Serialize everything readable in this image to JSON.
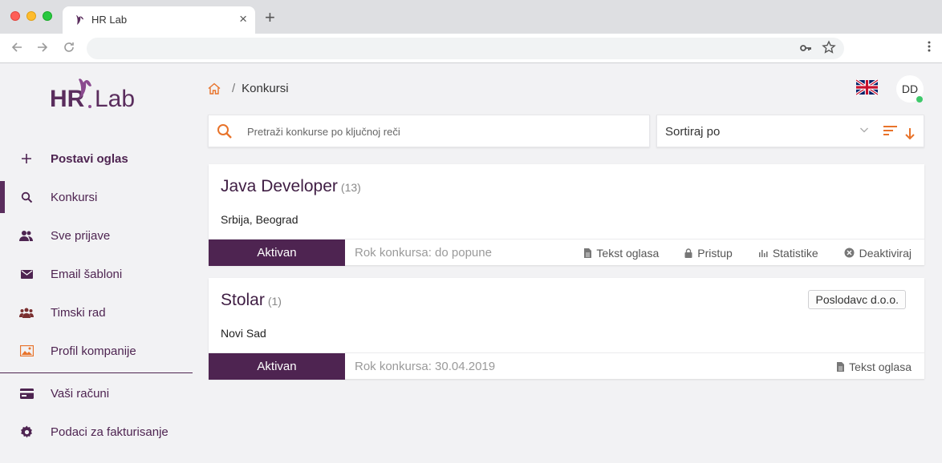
{
  "browser": {
    "tab_title": "HR Lab",
    "tab_close": "×",
    "new_tab": "+",
    "icons": [
      "back-arrow-icon",
      "forward-arrow-icon",
      "reload-icon",
      "key-icon",
      "star-icon",
      "menu-dots-icon"
    ]
  },
  "sidebar": {
    "logo": {
      "hr": "HR",
      "lab": "Lab"
    },
    "items": [
      {
        "label": "Postavi oglas",
        "icon": "plus-icon",
        "bold": true
      },
      {
        "label": "Konkursi",
        "icon": "search-icon",
        "active": true
      },
      {
        "label": "Sve prijave",
        "icon": "people-icon"
      },
      {
        "label": "Email šabloni",
        "icon": "envelope-icon"
      },
      {
        "label": "Timski rad",
        "icon": "team-icon"
      },
      {
        "label": "Profil kompanije",
        "icon": "image-icon"
      },
      {
        "label": "Vaši računi",
        "icon": "credit-card-icon"
      },
      {
        "label": "Podaci za fakturisanje",
        "icon": "gear-icon"
      }
    ]
  },
  "header": {
    "breadcrumb_sep": "/",
    "breadcrumb_current": "Konkursi",
    "avatar_initials": "DD",
    "language_flag": "uk-flag-icon"
  },
  "search": {
    "placeholder": "Pretraži konkurse po ključnoj reči",
    "value": ""
  },
  "sort": {
    "label": "Sortiraj po"
  },
  "jobs": [
    {
      "title": "Java Developer",
      "count": "(13)",
      "location": "Srbija, Beograd",
      "status": "Aktivan",
      "deadline": "Rok konkursa: do popune",
      "actions": [
        "Tekst oglasa",
        "Pristup",
        "Statistike",
        "Deaktiviraj"
      ]
    },
    {
      "title": "Stolar",
      "count": "(1)",
      "location": "Novi Sad",
      "company": "Poslodavc d.o.o.",
      "status": "Aktivan",
      "deadline": "Rok konkursa: 30.04.2019",
      "actions": [
        "Tekst oglasa"
      ]
    }
  ],
  "colors": {
    "brand_purple": "#4e2451",
    "accent_orange": "#e8732a",
    "online_green": "#3ec96a"
  }
}
